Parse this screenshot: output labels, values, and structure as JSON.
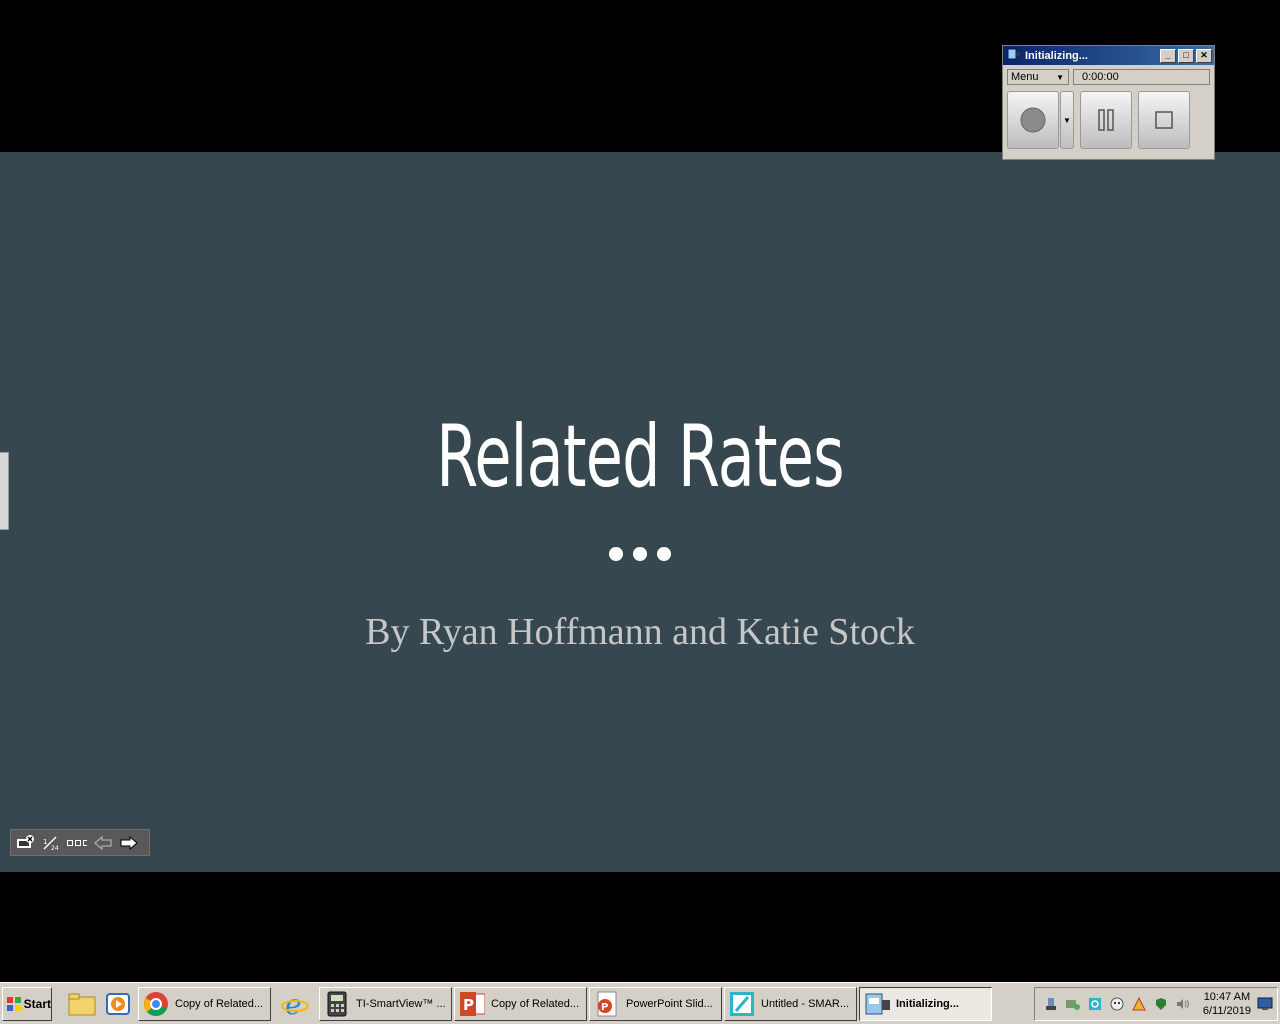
{
  "slide": {
    "title": "Related Rates",
    "subtitle": "By Ryan Hoffmann and Katie Stock",
    "background": "#37474f"
  },
  "presenter_toolbar": {
    "buttons": [
      "exit-slideshow-icon",
      "page-indicator-icon",
      "slide-sorter-icon",
      "previous-icon",
      "next-icon"
    ]
  },
  "recorder": {
    "title": "Initializing...",
    "menu_label": "Menu",
    "elapsed": "0:00:00"
  },
  "taskbar": {
    "start_label": "Start",
    "tasks": [
      {
        "label": "Copy of Related...",
        "icon": "chrome-icon"
      },
      {
        "label": "TI-SmartView™ ...",
        "icon": "calculator-icon"
      },
      {
        "label": "Copy of Related...",
        "icon": "powerpoint-icon"
      },
      {
        "label": "PowerPoint Slid...",
        "icon": "powerpoint-doc-icon"
      },
      {
        "label": "Untitled - SMAR...",
        "icon": "smart-notebook-icon"
      },
      {
        "label": "Initializing...",
        "icon": "recorder-icon",
        "active": true
      }
    ],
    "clock": {
      "time": "10:47 AM",
      "date": "6/11/2019"
    }
  }
}
